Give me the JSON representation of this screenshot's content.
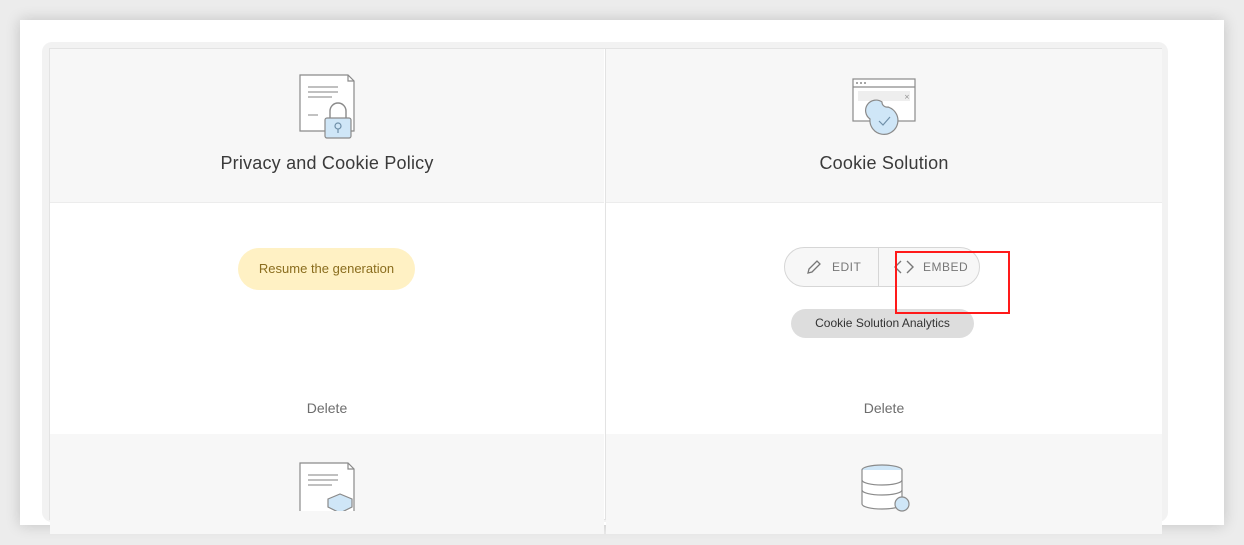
{
  "cards": {
    "privacy": {
      "title": "Privacy and Cookie Policy",
      "resume_label": "Resume the generation",
      "delete_label": "Delete"
    },
    "cookie": {
      "title": "Cookie Solution",
      "edit_label": "EDIT",
      "embed_label": "EMBED",
      "analytics_label": "Cookie Solution Analytics",
      "delete_label": "Delete"
    }
  },
  "icons": {
    "privacy": "document-lock-icon",
    "cookie": "browser-cookie-icon",
    "terms": "document-shield-icon",
    "database": "database-icon"
  },
  "colors": {
    "resume_bg": "#fff1c4",
    "highlight": "#ff1a1a",
    "icon_accent": "#cfe6f7"
  }
}
